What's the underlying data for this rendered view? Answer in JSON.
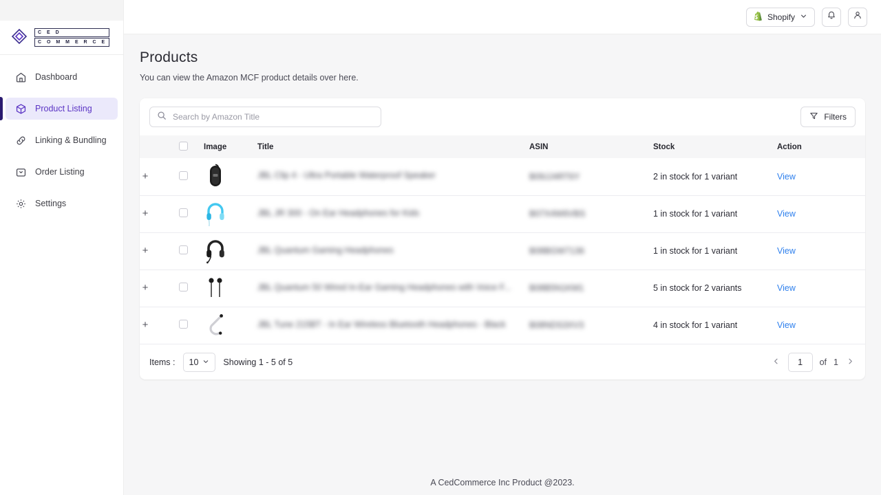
{
  "sidebar": {
    "logo": {
      "line1": "C E D",
      "line2": "C O M M E R C E",
      "icon": "ced-commerce-logo"
    },
    "items": [
      {
        "label": "Dashboard",
        "icon": "home-icon",
        "active": false
      },
      {
        "label": "Product Listing",
        "icon": "cube-icon",
        "active": true
      },
      {
        "label": "Linking & Bundling",
        "icon": "link-icon",
        "active": false
      },
      {
        "label": "Order Listing",
        "icon": "bag-icon",
        "active": false
      },
      {
        "label": "Settings",
        "icon": "gear-icon",
        "active": false
      }
    ]
  },
  "topbar": {
    "shopify_label": "Shopify",
    "shopify_icon": "shopify-bag-icon",
    "chevron_icon": "chevron-down-icon",
    "bell_icon": "bell-icon",
    "user_icon": "user-icon"
  },
  "header": {
    "title": "Products",
    "subtitle": "You can view the Amazon MCF product details over here."
  },
  "toolbar": {
    "search_placeholder": "Search by Amazon Title",
    "search_value": "",
    "search_icon": "search-icon",
    "filters_label": "Filters",
    "filter_icon": "funnel-icon"
  },
  "table": {
    "columns": [
      "",
      "",
      "Image",
      "Title",
      "ASIN",
      "Stock",
      "Action"
    ],
    "select_all_checked": false,
    "rows": [
      {
        "expand": "+",
        "checked": false,
        "image": "black-portable-speaker",
        "title": "JBL Clip 4 - Ultra Portable Waterproof Speaker",
        "asin": "B09JJ4RT6Y",
        "stock": "2 in stock for 1 variant",
        "action": "View"
      },
      {
        "expand": "+",
        "checked": false,
        "image": "blue-on-ear-headphones",
        "title": "JBL JR 300 - On Ear Headphones for Kids",
        "asin": "B07X4W6VBS",
        "stock": "1 in stock for 1 variant",
        "action": "View"
      },
      {
        "expand": "+",
        "checked": false,
        "image": "black-gaming-headset",
        "title": "JBL Quantum Gaming Headphones",
        "asin": "B08BGW7136",
        "stock": "1 in stock for 1 variant",
        "action": "View"
      },
      {
        "expand": "+",
        "checked": false,
        "image": "black-wired-earbuds",
        "title": "JBL Quantum 50 Wired In-Ear Gaming Headphones with Voice F...",
        "asin": "B08B5N1KM1",
        "stock": "5 in stock for 2 variants",
        "action": "View"
      },
      {
        "expand": "+",
        "checked": false,
        "image": "white-neckband-headphones",
        "title": "JBL Tune 215BT - In Ear Wireless Bluetooth Headphones - Black",
        "asin": "B08NDS3XV3",
        "stock": "4 in stock for 1 variant",
        "action": "View"
      }
    ]
  },
  "pagination": {
    "items_label": "Items :",
    "items_per_page": "10",
    "chevron_icon": "chevron-down-icon",
    "showing_text": "Showing 1 - 5 of 5",
    "prev_icon": "chevron-left-icon",
    "next_icon": "chevron-right-icon",
    "current_page": "1",
    "of_label": "of",
    "total_pages": "1"
  },
  "footer": {
    "text": "A CedCommerce Inc Product @2023."
  },
  "colors": {
    "accent": "#5b34c4",
    "accent_bar": "#2a1a70",
    "accent_bg": "#ebe9fb",
    "link": "#2f80ed",
    "page_bg": "#f6f6f7",
    "card_bg": "#ffffff",
    "border": "#ececf0"
  }
}
